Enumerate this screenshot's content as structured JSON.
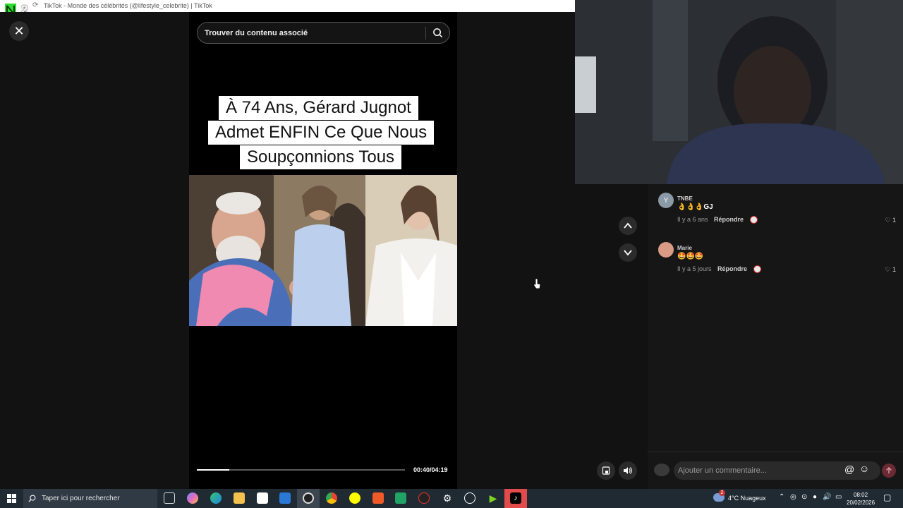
{
  "browser": {
    "window_title": "TikTok - Monde des célébrités (@lifestyle_celebrite) | TikTok",
    "logo_digit": "2"
  },
  "viewer": {
    "close_label": "✕",
    "search_placeholder": "Trouver du contenu associé",
    "caption_lines": [
      "À 74 Ans, Gérard Jugnot",
      "Admet ENFIN Ce Que Nous",
      "Soupçonnions Tous"
    ],
    "progress_fraction": 0.157,
    "progress_time": "00:40/04:19"
  },
  "comments": [
    {
      "user": "TNBE",
      "avatar_letter": "Y",
      "text": "👌👌👌GJ",
      "time": "Il y a 6 ans",
      "reply_label": "Répondre",
      "likes": "1"
    },
    {
      "user": "Marie",
      "avatar_letter": "",
      "text": "🤩🤩🤩",
      "time": "Il y a 5 jours",
      "reply_label": "Répondre",
      "likes": "1"
    }
  ],
  "comment_bar": {
    "placeholder": "Ajouter un commentaire...",
    "at_symbol": "@"
  },
  "taskbar": {
    "search_placeholder": "Taper ici pour rechercher",
    "weather_badge": "2",
    "weather": "4°C  Nuageux",
    "time": "08:02",
    "date": "20/02/2026"
  },
  "colors": {
    "tiktok_red": "#fe2c55",
    "taskbar_bg": "#1f2a33",
    "panel_bg": "#161616"
  }
}
